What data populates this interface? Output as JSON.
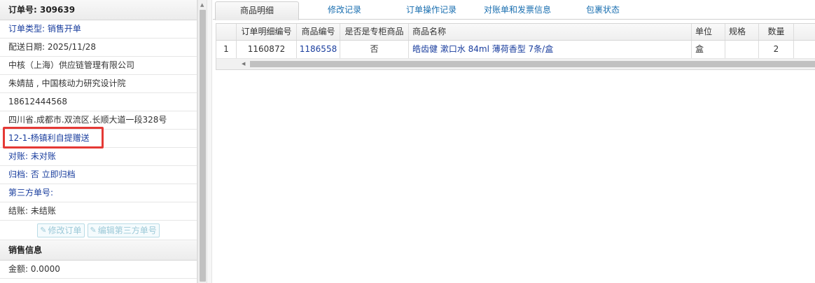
{
  "left": {
    "order_header": "订单号: 309639",
    "order_type": "订单类型: 销售开单",
    "delivery_date": "配送日期: 2025/11/28",
    "company": "中核（上海）供应链管理有限公司",
    "contact": "朱婧喆 , 中国核动力研究设计院",
    "phone": "18612444568",
    "address": "四川省.成都市.双流区.长顺大道一段328号",
    "note": "12-1-杨镇利自提赠送",
    "reconciliation": "对账: 未对账",
    "archive": "归档:  否 立即归档",
    "third_party_no": "第三方单号:",
    "settlement": "结账: 未结账",
    "buttons": {
      "edit_order": "修改订单",
      "edit_third_party": "编辑第三方单号"
    },
    "sales_header": "销售信息",
    "amount": "金额: 0.0000"
  },
  "tabs": [
    "商品明细",
    "修改记录",
    "订单操作记录",
    "对账单和发票信息",
    "包裹状态"
  ],
  "grid": {
    "headers": [
      "",
      "订单明细编号",
      "商品编号",
      "是否是专柜商品",
      "商品名称",
      "单位",
      "规格",
      "数量"
    ],
    "rows": [
      [
        "1",
        "1160872",
        "1186558",
        "否",
        "皓齿健 漱口水 84ml 薄荷香型 7条/盒",
        "盒",
        "",
        "2"
      ]
    ]
  },
  "colors": {
    "link_blue": "#1a3e9e",
    "highlight_red": "#e53935"
  },
  "icons": [
    "edit-icon",
    "scroll-up-icon",
    "scroll-left-icon"
  ]
}
